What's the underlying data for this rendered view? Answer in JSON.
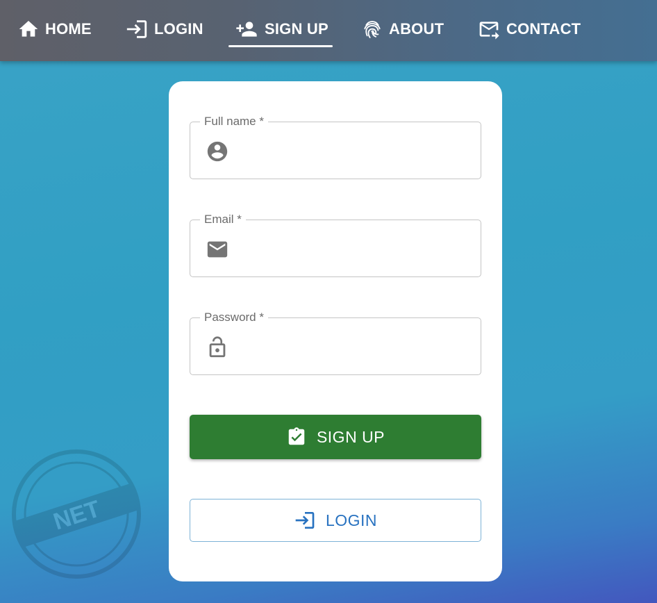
{
  "nav": {
    "home": "HOME",
    "login": "LOGIN",
    "signup": "SIGN UP",
    "about": "ABOUT",
    "contact": "CONTACT",
    "active": "signup"
  },
  "form": {
    "fullname": {
      "label": "Full name *",
      "value": "",
      "icon": "account-circle-icon"
    },
    "email": {
      "label": "Email *",
      "value": "",
      "icon": "mail-icon"
    },
    "password": {
      "label": "Password *",
      "value": "",
      "icon": "lock-open-icon"
    }
  },
  "buttons": {
    "signup": "SIGN UP",
    "login": "LOGIN"
  },
  "watermark": {
    "lines": [
      "NET"
    ]
  },
  "colors": {
    "navbar": "#5a6371",
    "background": "#349fc4",
    "signup_button": "#2e7d32",
    "login_text": "#2872c0",
    "field_icon": "#757575"
  }
}
